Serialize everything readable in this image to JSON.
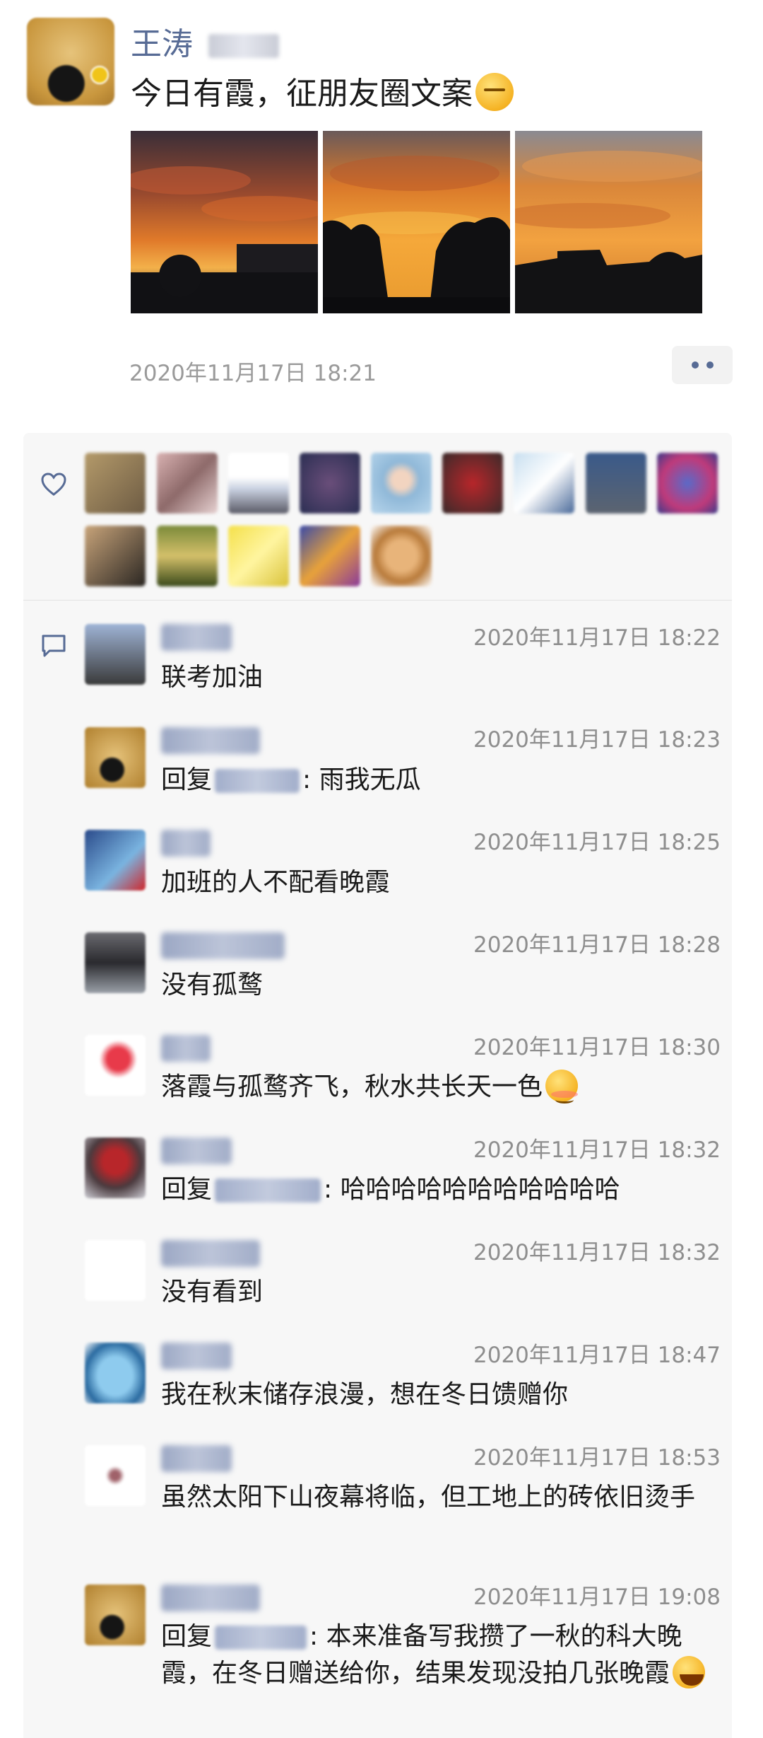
{
  "post": {
    "author": "王涛",
    "text": "今日有霞，征朋友圈文案",
    "time": "2020年11月17日 18:21",
    "emoji": "smirk-face"
  },
  "colors": {
    "name_link": "#576b95",
    "panel_bg": "#f7f7f7",
    "time_gray": "#9a9a9a"
  },
  "likes": {
    "icon": "heart-outline-icon",
    "count_avatars": 14
  },
  "comments_icon": "comment-bubble-icon",
  "comments": [
    {
      "time": "2020年11月17日 18:22",
      "text": "联考加油"
    },
    {
      "time": "2020年11月17日 18:23",
      "reply_prefix": "回复",
      "text": ": 雨我无瓜"
    },
    {
      "time": "2020年11月17日 18:25",
      "text": "加班的人不配看晚霞"
    },
    {
      "time": "2020年11月17日 18:28",
      "text": "没有孤鹜"
    },
    {
      "time": "2020年11月17日 18:30",
      "text": "落霞与孤鹜齐飞，秋水共长天一色",
      "emoji": "blush-face"
    },
    {
      "time": "2020年11月17日 18:32",
      "reply_prefix": "回复",
      "text": ": 哈哈哈哈哈哈哈哈哈哈哈"
    },
    {
      "time": "2020年11月17日 18:32",
      "text": "没有看到"
    },
    {
      "time": "2020年11月17日 18:47",
      "text": "我在秋末储存浪漫，想在冬日馈赠你"
    },
    {
      "time": "2020年11月17日 18:53",
      "text": "虽然太阳下山夜幕将临，但工地上的砖依旧烫手"
    },
    {
      "time": "2020年11月17日 19:08",
      "reply_prefix": "回复",
      "text": ": 本来准备写我攒了一秋的科大晚霞，在冬日赠送给你，结果发现没拍几张晚霞",
      "emoji": "laughing-tears-face"
    }
  ]
}
